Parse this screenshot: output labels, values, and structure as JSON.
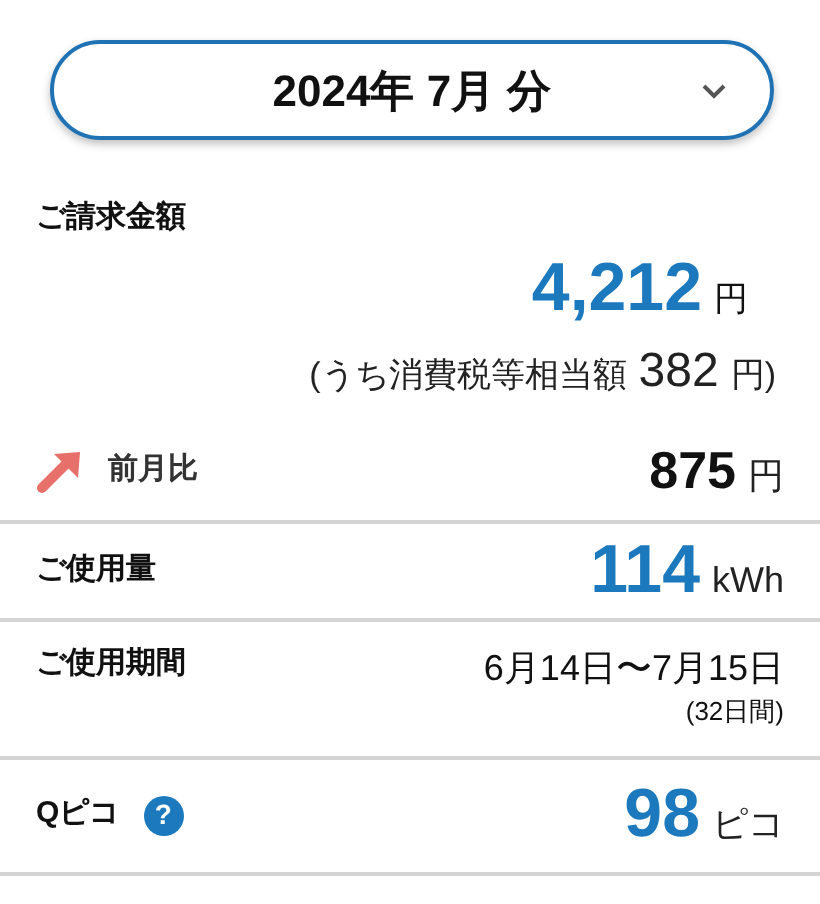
{
  "period_selector": {
    "label": "2024年 7月 分"
  },
  "billing": {
    "label": "ご請求金額",
    "amount": "4,212",
    "unit": "円",
    "tax_prefix": "(うち消費税等相当額",
    "tax_amount": "382",
    "tax_suffix": "円)"
  },
  "rows": [
    {
      "kind": "change",
      "increased": true,
      "label": "前月比",
      "value": "875",
      "unit": "円"
    },
    {
      "kind": "usage",
      "label": "ご使用量",
      "value": "114",
      "unit": "kWh"
    },
    {
      "kind": "period",
      "label": "ご使用期間",
      "value": "6月14日〜7月15日",
      "note": "(32日間)"
    },
    {
      "kind": "points",
      "label": "Qピコ",
      "help": "?",
      "value": "98",
      "unit": "ピコ"
    }
  ]
}
